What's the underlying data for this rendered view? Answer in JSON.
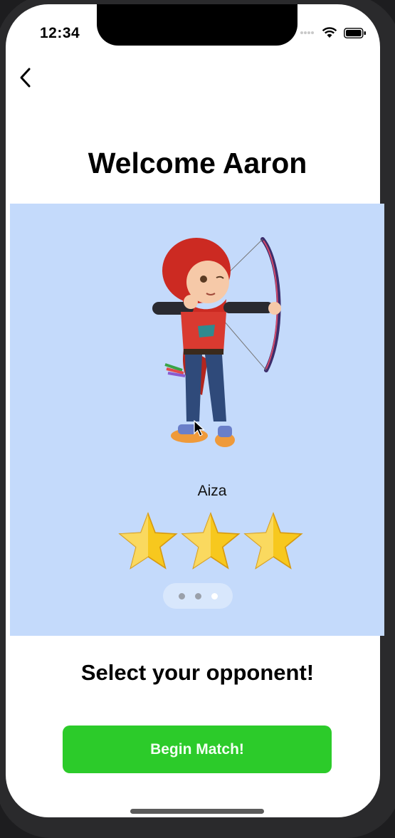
{
  "status_bar": {
    "time": "12:34",
    "icons": [
      "cellular-icon",
      "wifi-icon",
      "battery-icon"
    ]
  },
  "nav": {
    "back_icon": "chevron-left-icon"
  },
  "header": {
    "title": "Welcome Aaron"
  },
  "opponent_card": {
    "name": "Aiza",
    "image": "archer-girl-illustration",
    "stars": 3,
    "pager": {
      "count": 3,
      "active_index": 2
    }
  },
  "footer": {
    "subtitle": "Select your opponent!",
    "begin_label": "Begin Match!"
  },
  "colors": {
    "panel_bg": "#c4dafb",
    "button_bg": "#2ccb2a",
    "star": "#f7c81e"
  }
}
